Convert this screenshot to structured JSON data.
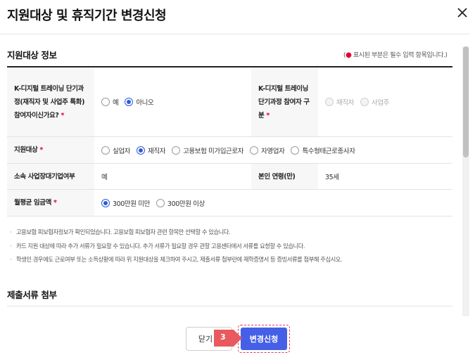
{
  "modal": {
    "title": "지원대상 및 휴직기간 변경신청"
  },
  "section1": {
    "title": "지원대상 정보",
    "required_note_open": "(",
    "required_note_dot": "●",
    "required_note_text": " 표시된 부분은 필수 입력 항목입니다.)"
  },
  "rows": {
    "kdigital": {
      "label": "K-디지털 트레이닝 단기과정(재직자 및 사업주 특화) 참여자이신가요?",
      "required": "*",
      "options": [
        "예",
        "아니오"
      ],
      "selected": "아니오",
      "label2": "K-디지털 트레이닝 단기과정 참여자 구분",
      "required2": "*",
      "options2": [
        "재직자",
        "사업주"
      ]
    },
    "target": {
      "label": "지원대상",
      "required": "*",
      "options": [
        "실업자",
        "재직자",
        "고용보험 미가입근로자",
        "자영업자",
        "특수형태근로종사자"
      ],
      "selected": "재직자"
    },
    "company": {
      "label": "소속 사업장대기업여부",
      "value": "예",
      "label2": "본인 연령(만)",
      "value2": "35세"
    },
    "wage": {
      "label": "월평균 임금액",
      "required": "*",
      "options": [
        "300만원 미만",
        "300만원 이상"
      ],
      "selected": "300만원 미만"
    }
  },
  "notes": [
    "고용보험 피보험자정보가 확인되었습니다. 고용보험 피보험자 관련 항목만 선택할 수 있습니다.",
    "카드 지원 대상에 따라 추가 서류가 필요할 수 있습니다. 추가 서류가 필요할 경우 관할 고용센터에서 서류를 요청할 수 있습니다.",
    "학생인 경우에도 근로여부 또는 소득상황에 따라 위 지원대상을 체크하여 주시고, 제출서류 첨부란에 재학증명서 등 증빙서류를 첨부해 주십시오."
  ],
  "section2": {
    "title": "제출서류 첨부"
  },
  "footer": {
    "close_label": "닫기",
    "submit_label": "변경신청",
    "step_number": "3"
  },
  "colors": {
    "accent": "#4560e6",
    "required": "#e6002d",
    "highlight": "#e23b5a"
  }
}
